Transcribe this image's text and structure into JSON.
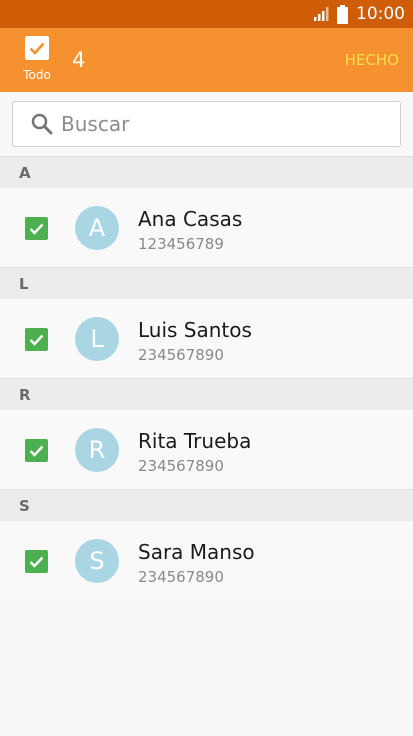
{
  "status_bar": {
    "time": "10:00",
    "signal_icon": "signal-icon",
    "battery_icon": "battery-icon"
  },
  "action_bar": {
    "select_all_label": "Todo",
    "selected_count": "4",
    "done_label": "HECHO"
  },
  "search": {
    "placeholder": "Buscar",
    "value": ""
  },
  "sections": [
    {
      "letter": "A",
      "contacts": [
        {
          "initial": "A",
          "name": "Ana Casas",
          "phone": "123456789",
          "checked": true
        }
      ]
    },
    {
      "letter": "L",
      "contacts": [
        {
          "initial": "L",
          "name": "Luis Santos",
          "phone": "234567890",
          "checked": true
        }
      ]
    },
    {
      "letter": "R",
      "contacts": [
        {
          "initial": "R",
          "name": "Rita Trueba",
          "phone": "234567890",
          "checked": true
        }
      ]
    },
    {
      "letter": "S",
      "contacts": [
        {
          "initial": "S",
          "name": "Sara Manso",
          "phone": "234567890",
          "checked": true
        }
      ]
    }
  ],
  "colors": {
    "status_bar": "#cf5c06",
    "action_bar": "#f5922f",
    "done_text": "#ffe04a",
    "checkbox": "#4caf50",
    "avatar": "#a9d6e2"
  }
}
